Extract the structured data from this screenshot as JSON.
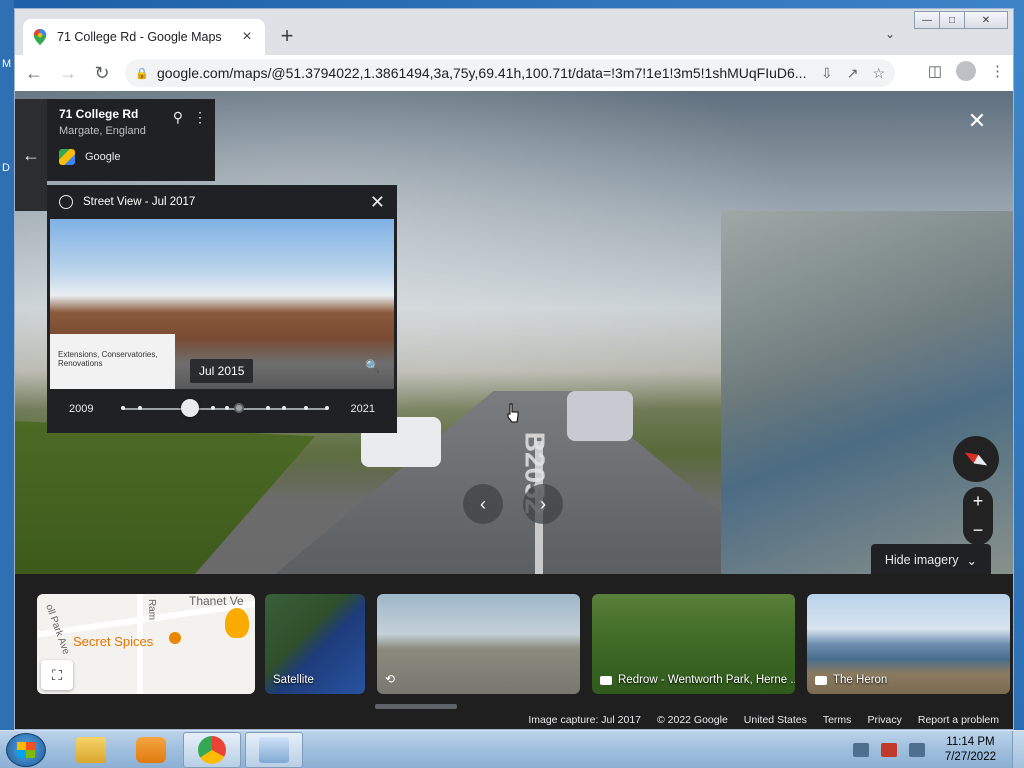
{
  "desktop": {
    "left_chars": [
      "M",
      "D"
    ]
  },
  "window": {
    "tab": {
      "title": "71 College Rd - Google Maps",
      "favicon": "google-maps-pin-icon"
    },
    "controls": {
      "minimize": "minimize-icon",
      "maximize": "maximize-icon",
      "close": "close-icon"
    }
  },
  "toolbar": {
    "url": "google.com/maps/@51.3794022,1.3861494,3a,75y,69.41h,100.71t/data=!3m7!1e1!3m5!1shMUqFIuD6..."
  },
  "address_card": {
    "title": "71 College Rd",
    "subtitle": "Margate, England",
    "source": "Google"
  },
  "time_machine": {
    "header": "Street View - Jul 2017",
    "thumb_date": "Jul 2015",
    "thumb_van_text": "Extensions, Conservatories, Renovations",
    "year_start": "2009",
    "year_end": "2021",
    "selected_fraction": 0.33
  },
  "road_marking": "B2052",
  "imagery": {
    "hide_label": "Hide imagery",
    "cards": [
      {
        "name": "map",
        "place": "Secret Spices",
        "area": "Thanet Ve",
        "streets": [
          "Ram",
          "oll Park Ave"
        ]
      },
      {
        "name": "satellite",
        "label": "Satellite"
      },
      {
        "name": "panorama",
        "label": ""
      },
      {
        "name": "wentworth",
        "label": "Redrow - Wentworth Park, Herne ..."
      },
      {
        "name": "heron",
        "label": "The Heron"
      }
    ]
  },
  "footer": {
    "items": [
      "Image capture: Jul 2017",
      "© 2022 Google",
      "United States",
      "Terms",
      "Privacy",
      "Report a problem"
    ]
  },
  "taskbar": {
    "time": "11:14 PM",
    "date": "7/27/2022",
    "apps": [
      "file-explorer-icon",
      "media-player-icon",
      "chrome-icon",
      "network-settings-icon"
    ]
  },
  "colors": {
    "panel": "#202124",
    "accent_red": "#d93025",
    "maps_orange": "#e37400"
  }
}
